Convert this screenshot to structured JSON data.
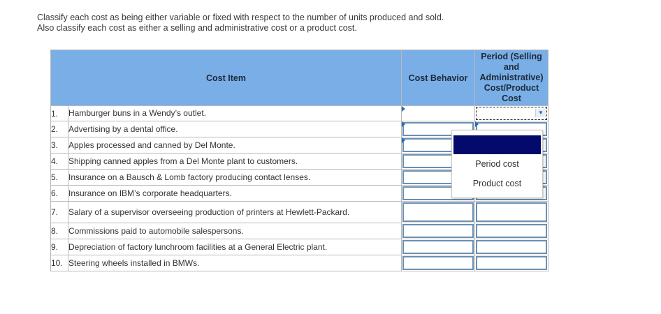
{
  "instructions": {
    "line1": "Classify each cost as being either variable or fixed with respect to the number of units produced and sold.",
    "line2": "Also classify each cost as either a selling and administrative cost or a product cost."
  },
  "table": {
    "col_item": "Cost Item",
    "col_behavior": "Cost Behavior",
    "col_period": [
      "Period (Selling",
      "and",
      "Administrative)",
      "Cost/Product",
      "Cost"
    ],
    "rows": [
      {
        "num": "1.",
        "item": "Hamburger buns in a Wendy’s outlet."
      },
      {
        "num": "2.",
        "item": "Advertising by a dental office."
      },
      {
        "num": "3.",
        "item": "Apples processed and canned by Del Monte."
      },
      {
        "num": "4.",
        "item": "Shipping canned apples from a Del Monte plant to customers."
      },
      {
        "num": "5.",
        "item": "Insurance on a Bausch & Lomb factory producing contact lenses."
      },
      {
        "num": "6.",
        "item": "Insurance on IBM’s corporate headquarters."
      },
      {
        "num": "7.",
        "item": "Salary of a supervisor overseeing production of printers at Hewlett-Packard."
      },
      {
        "num": "8.",
        "item": "Commissions paid to automobile salespersons."
      },
      {
        "num": "9.",
        "item": "Depreciation of factory lunchroom facilities at a General Electric plant."
      },
      {
        "num": "10.",
        "item": "Steering wheels installed in BMWs."
      }
    ]
  },
  "dropdown": {
    "options": [
      "Period cost",
      "Product cost"
    ],
    "arrow_icon": "chevron-down-icon"
  }
}
